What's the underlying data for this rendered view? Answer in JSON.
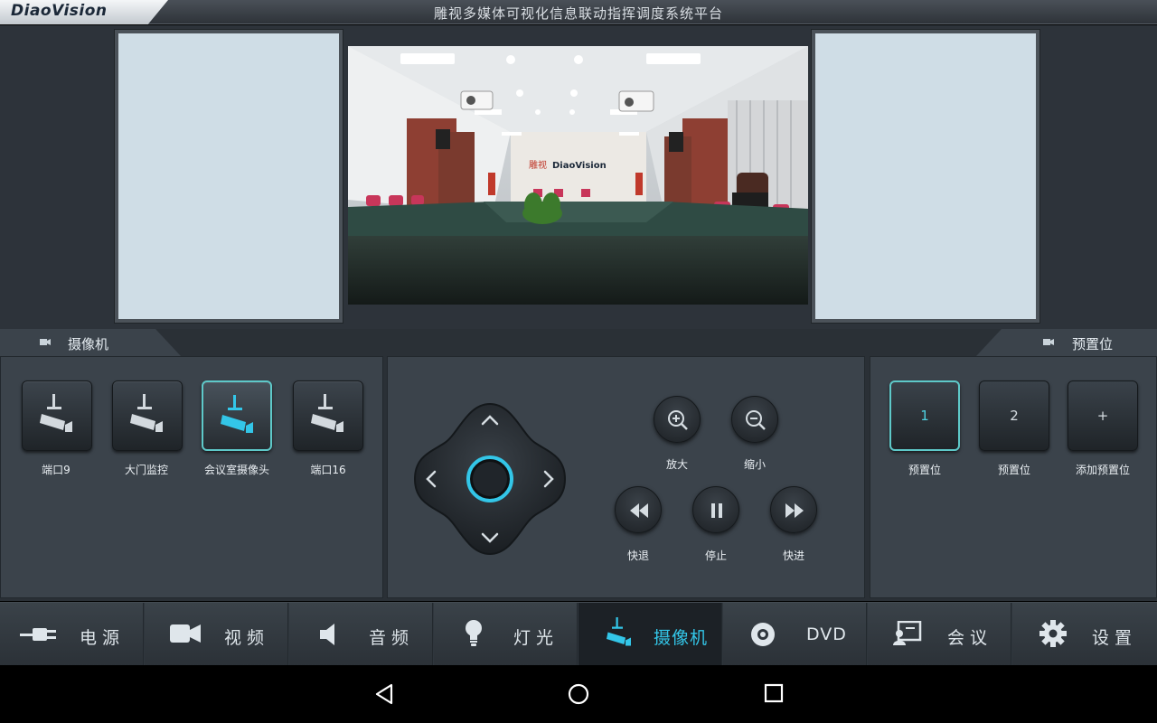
{
  "header": {
    "logo": "DiaoVision",
    "title": "雕视多媒体可视化信息联动指挥调度系统平台"
  },
  "camera_section": {
    "title": "摄像机",
    "cameras": [
      {
        "label": "端口9",
        "active": false
      },
      {
        "label": "大门监控",
        "active": false
      },
      {
        "label": "会议室摄像头",
        "active": true
      },
      {
        "label": "端口16",
        "active": false
      }
    ]
  },
  "ptz": {
    "zoom_in": "放大",
    "zoom_out": "缩小",
    "rewind": "快退",
    "stop": "停止",
    "forward": "快进"
  },
  "preset_section": {
    "title": "预置位",
    "presets": [
      {
        "value": "1",
        "label": "预置位",
        "active": true
      },
      {
        "value": "2",
        "label": "预置位",
        "active": false
      },
      {
        "value": "+",
        "label": "添加预置位",
        "active": false
      }
    ]
  },
  "nav": {
    "items": [
      {
        "label": "电源",
        "icon": "plug-icon"
      },
      {
        "label": "视频",
        "icon": "video-camera-icon"
      },
      {
        "label": "音频",
        "icon": "speaker-icon"
      },
      {
        "label": "灯光",
        "icon": "light-bulb-icon"
      },
      {
        "label": "摄像机",
        "icon": "security-camera-icon",
        "active": true
      },
      {
        "label": "DVD",
        "icon": "disc-icon"
      },
      {
        "label": "会议",
        "icon": "meeting-icon"
      },
      {
        "label": "设置",
        "icon": "gear-icon"
      }
    ]
  },
  "colors": {
    "accent": "#33c6e8",
    "panel_bg": "#3b434b",
    "screen_bg": "#cfdde6"
  }
}
